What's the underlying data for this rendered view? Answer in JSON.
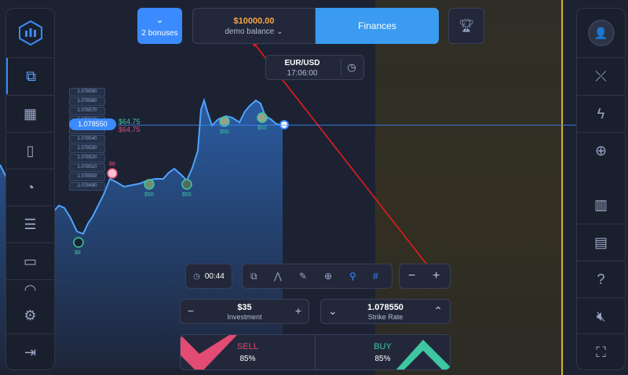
{
  "top": {
    "bonuses_label": "2 bonuses",
    "balance_amount": "$10000.00",
    "balance_type": "demo balance",
    "finances_label": "Finances"
  },
  "asset": {
    "name": "EUR/USD",
    "time": "17:06:00"
  },
  "ladder": [
    "1.078590",
    "1.078580",
    "1.078570",
    "1.078560",
    "1.078550",
    "1.078540",
    "1.078530",
    "1.078520",
    "1.078510",
    "1.078500",
    "1.078490"
  ],
  "current_price": "1.078550",
  "pl_up": "$64.75",
  "pl_down": "$64.75",
  "trade_markers": [
    "$8",
    "$8",
    "$50",
    "$50",
    "$50",
    "$50"
  ],
  "timer": "00:44",
  "investment": {
    "value": "$35",
    "label": "Investment"
  },
  "strike": {
    "value": "1.078550",
    "label": "Strike Rate"
  },
  "sell": {
    "label": "SELL",
    "pct": "85%"
  },
  "buy": {
    "label": "BUY",
    "pct": "85%"
  },
  "colors": {
    "accent": "#3b8bff",
    "sell": "#e24b74",
    "buy": "#3ec7a0",
    "balance": "#f7a548",
    "future_line": "#d6b12c"
  }
}
